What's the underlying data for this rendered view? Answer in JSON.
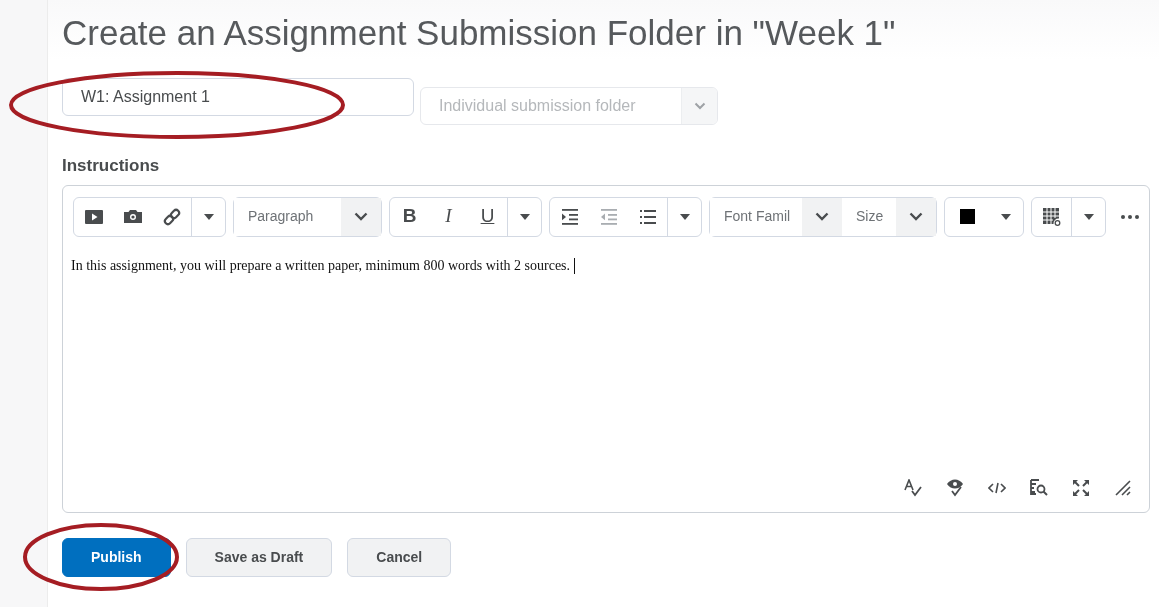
{
  "page_title": "Create an Assignment Submission Folder in \"Week 1\"",
  "name_field": {
    "value": "W1: Assignment 1"
  },
  "folder_type": {
    "value": "Individual submission folder",
    "disabled": true
  },
  "instructions_label": "Instructions",
  "editor": {
    "paragraph_select": "Paragraph",
    "bold": "B",
    "italic": "I",
    "underline": "U",
    "font_family_select": "Font Famil",
    "size_select": "Size",
    "content": "In this assignment, you will prepare a written paper, minimum 800 words with 2 sources."
  },
  "buttons": [
    {
      "label": "Publish",
      "kind": "primary"
    },
    {
      "label": "Save as Draft",
      "kind": "secondary"
    },
    {
      "label": "Cancel",
      "kind": "secondary"
    }
  ]
}
